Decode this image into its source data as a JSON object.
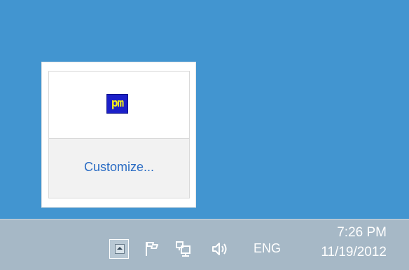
{
  "flyout": {
    "app_icon": {
      "label": "pm",
      "name": "pm-app-icon"
    },
    "customize_label": "Customize..."
  },
  "taskbar": {
    "overflow_button": "show-hidden-icons",
    "tray_icons": [
      "action-center-flag-icon",
      "network-icon",
      "volume-icon"
    ],
    "language": "ENG",
    "clock": {
      "time": "7:26 PM",
      "date": "11/19/2012"
    }
  },
  "colors": {
    "desktop": "#4295d0",
    "taskbar": "#a6b8c6",
    "link": "#2a6cc4",
    "pm_icon_bg": "#1c20c9",
    "pm_icon_fg": "#f4f01a"
  }
}
